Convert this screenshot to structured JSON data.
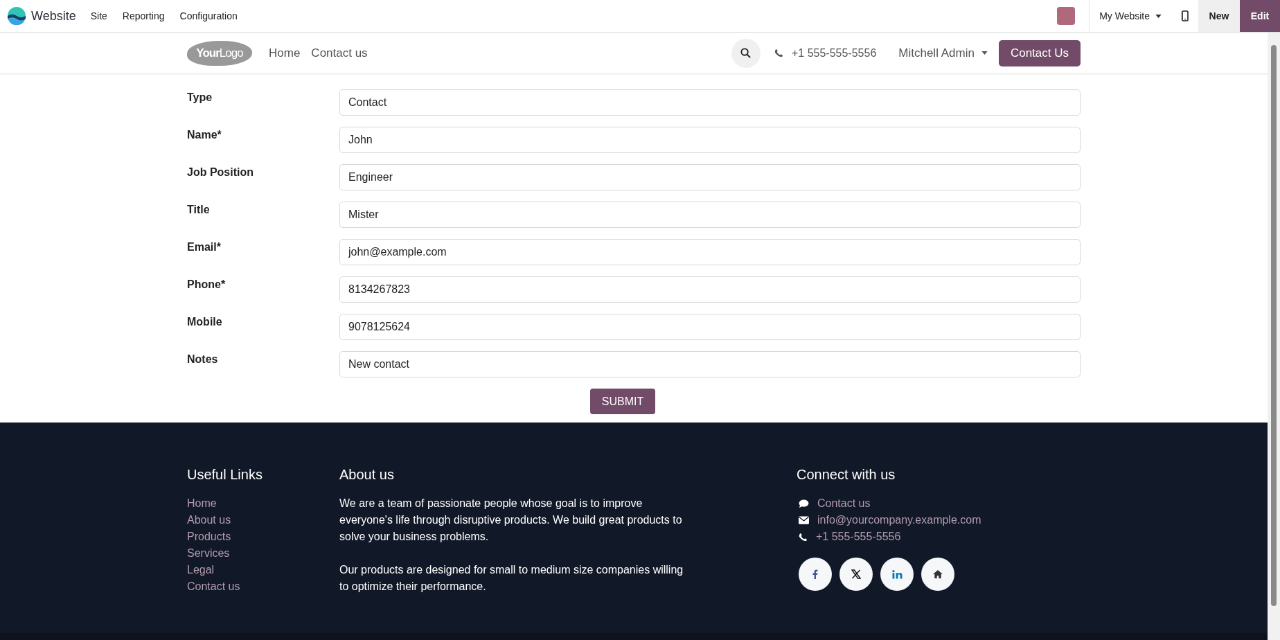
{
  "topbar": {
    "app_name": "Website",
    "menu": [
      "Site",
      "Reporting",
      "Configuration"
    ],
    "website_switcher": "My Website",
    "new_button": "New",
    "edit_button": "Edit"
  },
  "header": {
    "logo": {
      "part_1": "Your",
      "part_2": "Logo"
    },
    "nav": [
      "Home",
      "Contact us"
    ],
    "phone": "+1 555-555-5556",
    "user": "Mitchell Admin",
    "cta": "Contact Us"
  },
  "form": {
    "fields": [
      {
        "label": "Type",
        "value": "Contact"
      },
      {
        "label": "Name*",
        "value": "John"
      },
      {
        "label": "Job Position",
        "value": "Engineer"
      },
      {
        "label": "Title",
        "value": "Mister"
      },
      {
        "label": "Email*",
        "value": "john@example.com"
      },
      {
        "label": "Phone*",
        "value": "8134267823"
      },
      {
        "label": "Mobile",
        "value": "9078125624"
      },
      {
        "label": "Notes",
        "value": "New contact"
      }
    ],
    "submit": "SUBMIT"
  },
  "footer": {
    "useful_links": {
      "title": "Useful Links",
      "links": [
        "Home",
        "About us",
        "Products",
        "Services",
        "Legal",
        "Contact us"
      ]
    },
    "about": {
      "title": "About us",
      "paragraphs": [
        "We are a team of passionate people whose goal is to improve everyone's life through disruptive products. We build great products to solve your business problems.",
        "Our products are designed for small to medium size companies willing to optimize their performance."
      ]
    },
    "connect": {
      "title": "Connect with us",
      "items": [
        {
          "kind": "chat",
          "text": "Contact us"
        },
        {
          "kind": "mail",
          "text": "info@yourcompany.example.com"
        },
        {
          "kind": "phone",
          "text": "+1 555-555-5556"
        }
      ],
      "social": [
        {
          "kind": "facebook"
        },
        {
          "kind": "x"
        },
        {
          "kind": "linkedin"
        },
        {
          "kind": "home"
        }
      ]
    }
  }
}
